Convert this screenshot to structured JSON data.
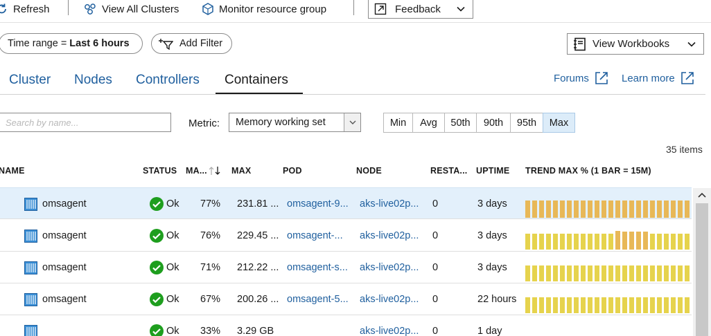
{
  "toolbar": {
    "refresh": "Refresh",
    "view_all_clusters": "View All Clusters",
    "monitor_resource_group": "Monitor resource group",
    "feedback": "Feedback"
  },
  "filters": {
    "time_range_label": "Time range =",
    "time_range_value": "Last 6 hours",
    "add_filter": "Add Filter",
    "view_workbooks": "View Workbooks"
  },
  "tabs": [
    {
      "label": "Cluster",
      "active": false
    },
    {
      "label": "Nodes",
      "active": false
    },
    {
      "label": "Controllers",
      "active": false
    },
    {
      "label": "Containers",
      "active": true
    }
  ],
  "links": {
    "forums": "Forums",
    "learn_more": "Learn more"
  },
  "search": {
    "placeholder": "Search by name..."
  },
  "metric": {
    "label": "Metric:",
    "selected": "Memory working set"
  },
  "aggregations": [
    {
      "label": "Min",
      "active": false
    },
    {
      "label": "Avg",
      "active": false
    },
    {
      "label": "50th",
      "active": false
    },
    {
      "label": "90th",
      "active": false
    },
    {
      "label": "95th",
      "active": false
    },
    {
      "label": "Max",
      "active": true
    }
  ],
  "items_count": "35 items",
  "columns": {
    "name": "NAME",
    "status": "STATUS",
    "max_pct": "MA...",
    "max": "MAX",
    "pod": "POD",
    "node": "NODE",
    "restarts": "RESTA...",
    "uptime": "UPTIME",
    "trend": "TREND MAX % (1 BAR = 15M)"
  },
  "rows": [
    {
      "name": "omsagent",
      "status": "Ok",
      "max_pct": "77%",
      "max": "231.81 ...",
      "pod": "omsagent-9...",
      "node": "aks-live02p...",
      "restarts": "0",
      "uptime": "3 days",
      "trend_style": "orange",
      "trend": [
        0.93,
        0.93,
        0.93,
        0.93,
        0.93,
        0.93,
        0.93,
        0.93,
        0.93,
        0.93,
        0.93,
        0.93,
        0.93,
        0.93,
        0.93,
        0.93,
        0.93,
        0.93,
        0.93,
        0.93,
        0.93,
        0.93,
        0.93,
        0.93
      ]
    },
    {
      "name": "omsagent",
      "status": "Ok",
      "max_pct": "76%",
      "max": "229.45 ...",
      "pod": "omsagent-...",
      "node": "aks-live02p...",
      "restarts": "0",
      "uptime": "3 days",
      "trend_style": "mixed",
      "trend": [
        0.85,
        0.85,
        0.85,
        0.85,
        0.85,
        0.85,
        0.85,
        0.85,
        0.85,
        0.85,
        0.85,
        0.85,
        0.85,
        1.0,
        0.97,
        0.97,
        0.97,
        0.97,
        0.85,
        0.85,
        0.85,
        0.85,
        0.85,
        0.85
      ]
    },
    {
      "name": "omsagent",
      "status": "Ok",
      "max_pct": "71%",
      "max": "212.22 ...",
      "pod": "omsagent-s...",
      "node": "aks-live02p...",
      "restarts": "0",
      "uptime": "3 days",
      "trend_style": "mixed",
      "trend": [
        0.85,
        0.85,
        0.85,
        0.85,
        0.85,
        0.85,
        0.85,
        0.85,
        0.85,
        0.85,
        0.85,
        0.85,
        0.85,
        0.85,
        0.85,
        0.85,
        0.85,
        0.85,
        0.85,
        0.85,
        0.85,
        0.85,
        0.85,
        0.85
      ]
    },
    {
      "name": "omsagent",
      "status": "Ok",
      "max_pct": "67%",
      "max": "200.26 ...",
      "pod": "omsagent-5...",
      "node": "aks-live02p...",
      "restarts": "0",
      "uptime": "22 hours",
      "trend_style": "yellow",
      "trend": [
        0.85,
        0.85,
        0.85,
        0.85,
        0.85,
        0.85,
        0.85,
        0.85,
        0.85,
        0.85,
        0.85,
        0.85,
        0.85,
        0.85,
        0.85,
        0.85,
        0.85,
        0.85,
        0.85,
        0.85,
        0.85,
        0.85,
        0.85,
        0.85
      ]
    },
    {
      "name": "",
      "status": "Ok",
      "max_pct": "33%",
      "max": "3.29 GB",
      "pod": "",
      "node": "aks-live02p...",
      "restarts": "0",
      "uptime": "1 day",
      "trend_style": "yellow",
      "trend": []
    }
  ]
}
